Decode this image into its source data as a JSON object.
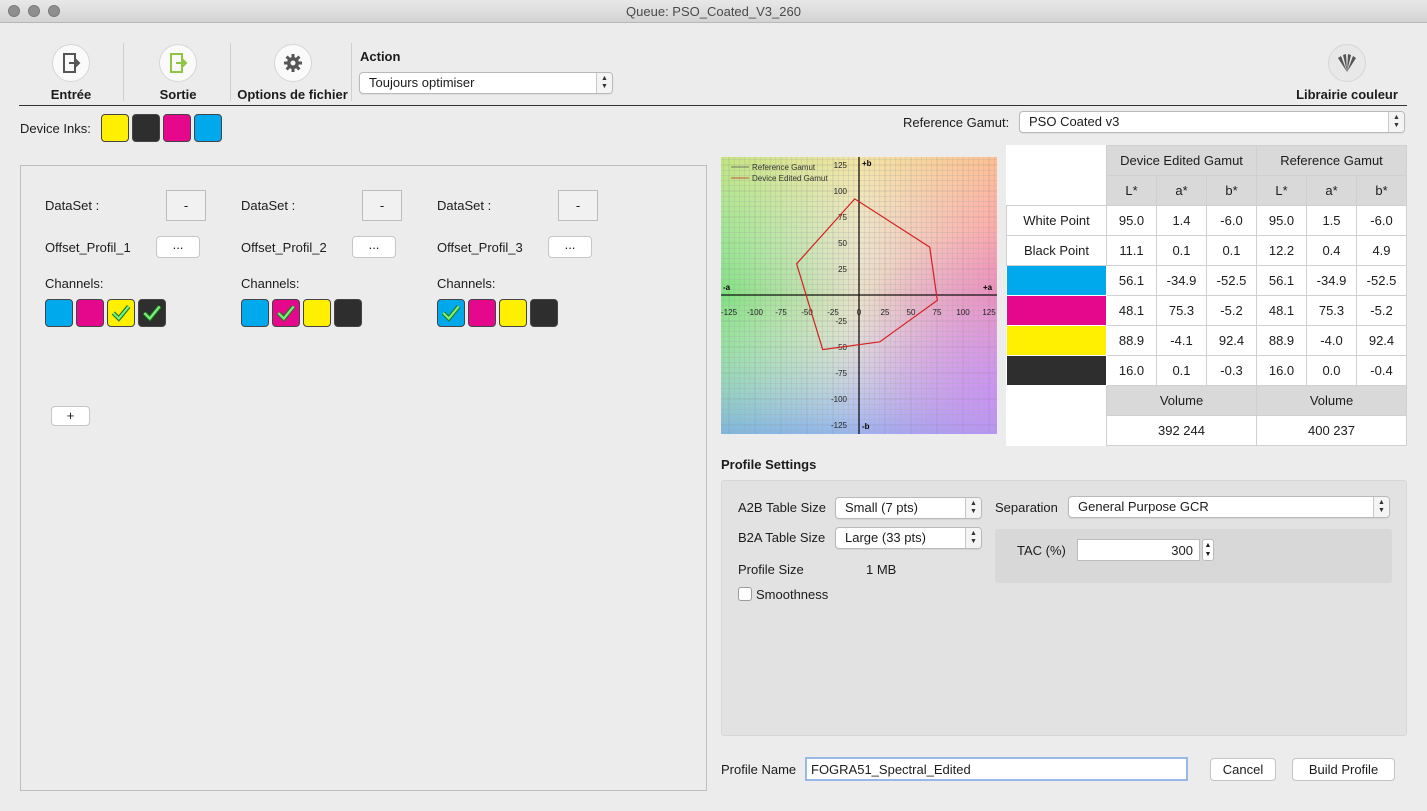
{
  "window": {
    "title": "Queue: PSO_Coated_V3_260"
  },
  "toolbar": {
    "entree": "Entrée",
    "sortie": "Sortie",
    "options": "Options de fichier",
    "action_label": "Action",
    "action_value": "Toujours optimiser",
    "librairie": "Librairie couleur"
  },
  "device_inks": {
    "label": "Device Inks:",
    "colors": [
      "#ffef00",
      "#2e2e2e",
      "#e5078c",
      "#00a8ec"
    ]
  },
  "reference_gamut": {
    "label": "Reference Gamut:",
    "value": "PSO Coated v3"
  },
  "datasets": [
    {
      "label": "DataSet :",
      "minus": "-",
      "profile": "Offset_Profil_1",
      "browse": "...",
      "channels_label": "Channels:",
      "channels": [
        {
          "color": "#00a8ec",
          "checked": false
        },
        {
          "color": "#e5078c",
          "checked": false
        },
        {
          "color": "#ffef00",
          "checked": true
        },
        {
          "color": "#2e2e2e",
          "checked": true
        }
      ]
    },
    {
      "label": "DataSet :",
      "minus": "-",
      "profile": "Offset_Profil_2",
      "browse": "...",
      "channels_label": "Channels:",
      "channels": [
        {
          "color": "#00a8ec",
          "checked": false
        },
        {
          "color": "#e5078c",
          "checked": true
        },
        {
          "color": "#ffef00",
          "checked": false
        },
        {
          "color": "#2e2e2e",
          "checked": false
        }
      ]
    },
    {
      "label": "DataSet :",
      "minus": "-",
      "profile": "Offset_Profil_3",
      "browse": "...",
      "channels_label": "Channels:",
      "channels": [
        {
          "color": "#00a8ec",
          "checked": true
        },
        {
          "color": "#e5078c",
          "checked": false
        },
        {
          "color": "#ffef00",
          "checked": false
        },
        {
          "color": "#2e2e2e",
          "checked": false
        }
      ]
    }
  ],
  "add_button": "+",
  "gamut_plot": {
    "legend": [
      "Reference Gamut",
      "Device Edited Gamut"
    ],
    "axis_labels": {
      "pos_b": "+b",
      "neg_b": "-b",
      "neg_a": "-a",
      "pos_a": "+a"
    },
    "a_ticks": [
      "-125",
      "-100",
      "-75",
      "-50",
      "-25",
      "0",
      "25",
      "50",
      "75",
      "100",
      "125"
    ],
    "b_ticks": [
      "125",
      "100",
      "75",
      "50",
      "25",
      "0",
      "-25",
      "-50",
      "-75",
      "-100",
      "-125"
    ],
    "device_polygon_ab": [
      [
        -4.1,
        92.4
      ],
      [
        -34.9,
        -52.5
      ],
      [
        75.3,
        -5.2
      ],
      [
        56.1,
        0
      ],
      [
        -60,
        30
      ],
      [
        20,
        -45
      ]
    ],
    "line_color": "#d42020"
  },
  "gamut_table": {
    "group_headers": [
      "Device Edited Gamut",
      "Reference Gamut"
    ],
    "col_headers": [
      "L*",
      "a*",
      "b*",
      "L*",
      "a*",
      "b*"
    ],
    "rows": [
      {
        "label": "White Point",
        "swatch": "",
        "values": [
          "95.0",
          "1.4",
          "-6.0",
          "95.0",
          "1.5",
          "-6.0"
        ]
      },
      {
        "label": "Black Point",
        "swatch": "",
        "values": [
          "11.1",
          "0.1",
          "0.1",
          "12.2",
          "0.4",
          "4.9"
        ]
      },
      {
        "label": "",
        "swatch": "#00a8ec",
        "values": [
          "56.1",
          "-34.9",
          "-52.5",
          "56.1",
          "-34.9",
          "-52.5"
        ]
      },
      {
        "label": "",
        "swatch": "#e5078c",
        "values": [
          "48.1",
          "75.3",
          "-5.2",
          "48.1",
          "75.3",
          "-5.2"
        ]
      },
      {
        "label": "",
        "swatch": "#ffef00",
        "values": [
          "88.9",
          "-4.1",
          "92.4",
          "88.9",
          "-4.0",
          "92.4"
        ]
      },
      {
        "label": "",
        "swatch": "#2e2e2e",
        "values": [
          "16.0",
          "0.1",
          "-0.3",
          "16.0",
          "0.0",
          "-0.4"
        ]
      }
    ],
    "volume_label": "Volume",
    "volumes": [
      "392 244",
      "400 237"
    ]
  },
  "profile_settings": {
    "title": "Profile Settings",
    "a2b_label": "A2B Table Size",
    "a2b_value": "Small (7 pts)",
    "b2a_label": "B2A Table Size",
    "b2a_value": "Large (33 pts)",
    "size_label": "Profile Size",
    "size_value": "1 MB",
    "smoothness": "Smoothness",
    "separation_label": "Separation",
    "separation_value": "General Purpose GCR",
    "tac_label": "TAC (%)",
    "tac_value": "300"
  },
  "footer": {
    "profile_name_label": "Profile Name",
    "profile_name_value": "FOGRA51_Spectral_Edited",
    "cancel": "Cancel",
    "build": "Build Profile"
  }
}
